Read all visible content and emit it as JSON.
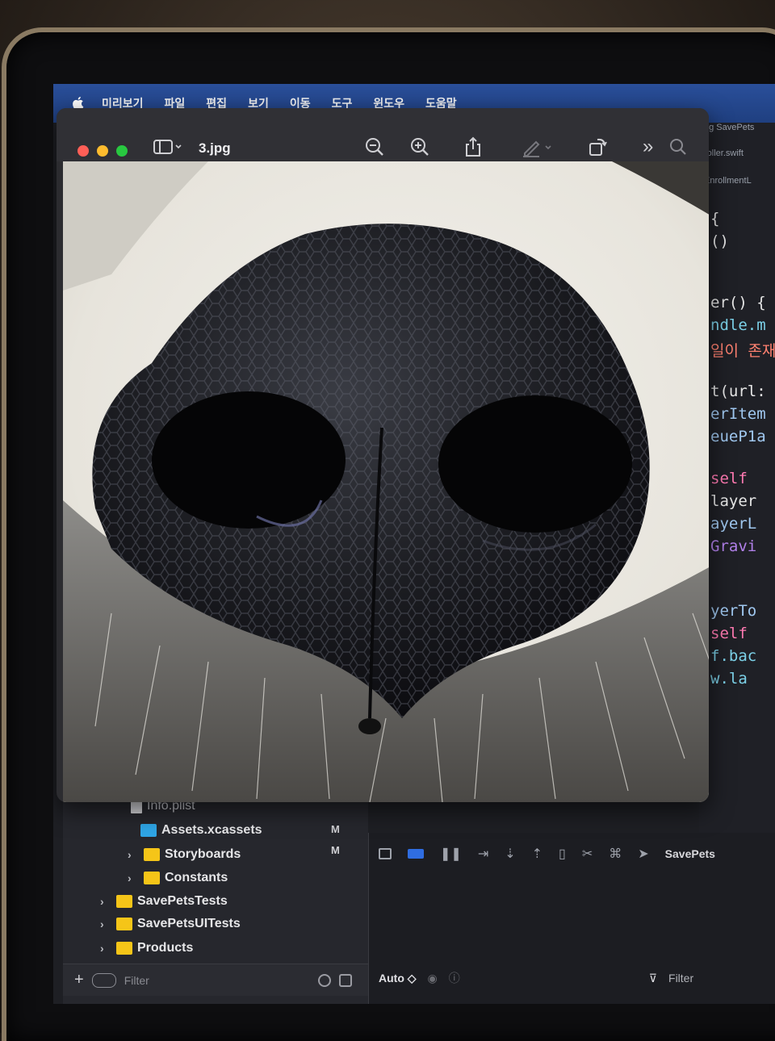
{
  "menubar": {
    "items": [
      "미리보기",
      "파일",
      "편집",
      "보기",
      "이동",
      "도구",
      "윈도우",
      "도움말"
    ]
  },
  "preview_window": {
    "title": "3.jpg",
    "toolbar_icons": [
      "sidebar-toggle-icon",
      "zoom-out-icon",
      "zoom-in-icon",
      "share-icon",
      "markup-icon",
      "rotate-icon",
      "more-icon",
      "search-icon"
    ]
  },
  "editor": {
    "tab1": "ng SavePets",
    "tab2": "roller.swift",
    "tab3": "EnrollmentL",
    "lines": [
      {
        "text": "{",
        "color": "#e6e6e6"
      },
      {
        "text": "()",
        "color": "#e6e6e6"
      },
      {
        "text": "er() {",
        "color": "#e6e6e6"
      },
      {
        "text": "ndle.m",
        "color": "#7cd1e8"
      },
      {
        "text": "일이 존재",
        "color": "#ff8170"
      },
      {
        "text": "t(url:",
        "color": "#e6e6e6"
      },
      {
        "text": "erItem",
        "color": "#a0c8f0"
      },
      {
        "text": "eueP1a",
        "color": "#a0c8f0"
      },
      {
        "text": "self",
        "color": "#ff7ab2"
      },
      {
        "text": "layer",
        "color": "#e6e6e6"
      },
      {
        "text": "ayerL",
        "color": "#a0c8f0"
      },
      {
        "text": "Gravi",
        "color": "#b281eb"
      },
      {
        "text": "yerTo",
        "color": "#a0c8f0"
      },
      {
        "text": "self",
        "color": "#ff7ab2"
      },
      {
        "text": "f.bac",
        "color": "#7cd1e8"
      },
      {
        "text": "w.la",
        "color": "#7cd1e8"
      }
    ]
  },
  "navigator": {
    "items": [
      {
        "label": "Info.plist",
        "icon": "file-icon",
        "badge": ""
      },
      {
        "label": "Assets.xcassets",
        "icon": "asset-folder-icon",
        "badge": "M"
      },
      {
        "label": "Storyboards",
        "icon": "folder-icon",
        "badge": "M"
      },
      {
        "label": "Constants",
        "icon": "folder-icon",
        "badge": ""
      },
      {
        "label": "SavePetsTests",
        "icon": "folder-icon",
        "badge": ""
      },
      {
        "label": "SavePetsUITests",
        "icon": "folder-icon",
        "badge": ""
      },
      {
        "label": "Products",
        "icon": "folder-icon",
        "badge": ""
      }
    ],
    "filter_placeholder": "Filter"
  },
  "debug": {
    "scheme": "SavePets",
    "auto_label": "Auto ◇",
    "filter_placeholder": "Filter"
  }
}
